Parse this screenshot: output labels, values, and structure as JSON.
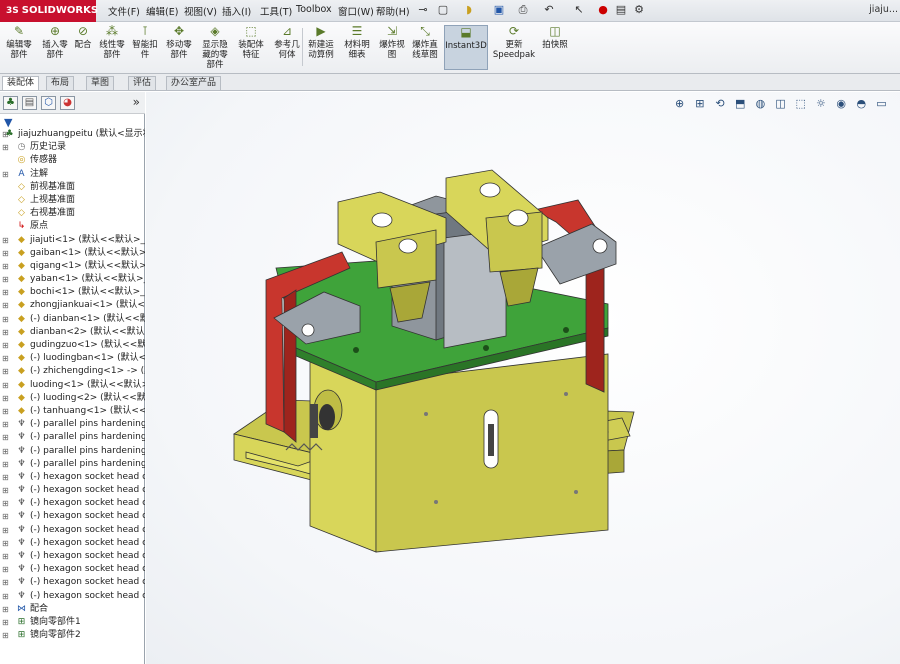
{
  "app": {
    "brand": "SOLIDWORKS",
    "brand_prefix": "3S",
    "document_title": "jiaju..."
  },
  "menu": {
    "items": [
      "文件(F)",
      "编辑(E)",
      "视图(V)",
      "插入(I)",
      "工具(T)",
      "Toolbox",
      "窗口(W)",
      "帮助(H)"
    ]
  },
  "commands": [
    {
      "label": "编辑零\n部件",
      "icon": "edit-component-icon"
    },
    {
      "label": "插入零\n部件",
      "icon": "insert-component-icon"
    },
    {
      "label": "配合",
      "icon": "mate-icon"
    },
    {
      "label": "线性零\n部件",
      "icon": "linear-pattern-icon"
    },
    {
      "label": "智能扣\n件",
      "icon": "smart-fastener-icon"
    },
    {
      "label": "移动零\n部件",
      "icon": "move-component-icon"
    },
    {
      "label": "显示隐\n藏的零\n部件",
      "icon": "show-hidden-icon"
    },
    {
      "label": "装配体\n特征",
      "icon": "assembly-feature-icon"
    },
    {
      "label": "参考几\n何体",
      "icon": "reference-geometry-icon"
    },
    {
      "label": "新建运\n动算例",
      "icon": "motion-study-icon"
    },
    {
      "label": "材料明\n细表",
      "icon": "bom-icon"
    },
    {
      "label": "爆炸视\n图",
      "icon": "exploded-view-icon"
    },
    {
      "label": "爆炸直\n线草图",
      "icon": "explode-line-icon"
    },
    {
      "label": "Instant3D",
      "icon": "instant3d-icon"
    },
    {
      "label": "更新\nSpeedpak",
      "icon": "speedpak-icon"
    },
    {
      "label": "拍快照",
      "icon": "snapshot-icon"
    }
  ],
  "tabs": [
    "装配体",
    "布局",
    "草图",
    "评估",
    "办公室产品"
  ],
  "tree": {
    "root": "jiajuzhuangpeitu  (默认<显示状",
    "items": [
      {
        "label": "历史记录",
        "icon": "history-icon",
        "expand": true,
        "indent": 1
      },
      {
        "label": "传感器",
        "icon": "sensor-icon",
        "expand": false,
        "indent": 1
      },
      {
        "label": "注解",
        "icon": "annotation-icon",
        "expand": true,
        "indent": 1
      },
      {
        "label": "前视基准面",
        "icon": "plane-icon",
        "expand": false,
        "indent": 1
      },
      {
        "label": "上视基准面",
        "icon": "plane-icon",
        "expand": false,
        "indent": 1
      },
      {
        "label": "右视基准面",
        "icon": "plane-icon",
        "expand": false,
        "indent": 1
      },
      {
        "label": "原点",
        "icon": "origin-icon",
        "expand": false,
        "indent": 1
      },
      {
        "label": "jiajuti<1> (默认<<默认>_显",
        "icon": "part-icon",
        "expand": true,
        "indent": 1
      },
      {
        "label": "gaiban<1> (默认<<默认>_",
        "icon": "part-icon",
        "expand": true,
        "indent": 1
      },
      {
        "label": "qigang<1> (默认<<默认>_",
        "icon": "part-icon",
        "expand": true,
        "indent": 1
      },
      {
        "label": "yaban<1> (默认<<默认>_显",
        "icon": "part-icon",
        "expand": true,
        "indent": 1
      },
      {
        "label": "bochi<1> (默认<<默认>_显",
        "icon": "part-icon",
        "expand": true,
        "indent": 1
      },
      {
        "label": "zhongjiankuai<1> (默认<<",
        "icon": "part-icon",
        "expand": true,
        "indent": 1
      },
      {
        "label": "(-) dianban<1> (默认<<默",
        "icon": "part-icon",
        "expand": true,
        "indent": 1
      },
      {
        "label": "dianban<2> (默认<<默认>",
        "icon": "part-icon",
        "expand": true,
        "indent": 1
      },
      {
        "label": "gudingzuo<1> (默认<<默认",
        "icon": "part-icon",
        "expand": true,
        "indent": 1
      },
      {
        "label": "(-) luodingban<1> (默认<<",
        "icon": "part-icon",
        "expand": true,
        "indent": 1
      },
      {
        "label": "(-) zhichengding<1> -> (默",
        "icon": "part-icon",
        "expand": true,
        "indent": 1
      },
      {
        "label": "luoding<1> (默认<<默认>_",
        "icon": "part-icon",
        "expand": true,
        "indent": 1
      },
      {
        "label": "(-) luoding<2> (默认<<默",
        "icon": "part-icon",
        "expand": true,
        "indent": 1
      },
      {
        "label": "(-) tanhuang<1> (默认<<默",
        "icon": "part-icon",
        "expand": true,
        "indent": 1
      },
      {
        "label": "(-) parallel pins hardening",
        "icon": "toolbox-icon",
        "expand": true,
        "indent": 1
      },
      {
        "label": "(-) parallel pins hardening",
        "icon": "toolbox-icon",
        "expand": true,
        "indent": 1
      },
      {
        "label": "(-) parallel pins hardening",
        "icon": "toolbox-icon",
        "expand": true,
        "indent": 1
      },
      {
        "label": "(-) parallel pins hardening",
        "icon": "toolbox-icon",
        "expand": true,
        "indent": 1
      },
      {
        "label": "(-) hexagon socket head c",
        "icon": "toolbox-icon",
        "expand": true,
        "indent": 1
      },
      {
        "label": "(-) hexagon socket head c",
        "icon": "toolbox-icon",
        "expand": true,
        "indent": 1
      },
      {
        "label": "(-) hexagon socket head c",
        "icon": "toolbox-icon",
        "expand": true,
        "indent": 1
      },
      {
        "label": "(-) hexagon socket head c",
        "icon": "toolbox-icon",
        "expand": true,
        "indent": 1
      },
      {
        "label": "(-) hexagon socket head c",
        "icon": "toolbox-icon",
        "expand": true,
        "indent": 1
      },
      {
        "label": "(-) hexagon socket head c",
        "icon": "toolbox-icon",
        "expand": true,
        "indent": 1
      },
      {
        "label": "(-) hexagon socket head c",
        "icon": "toolbox-icon",
        "expand": true,
        "indent": 1
      },
      {
        "label": "(-) hexagon socket head c",
        "icon": "toolbox-icon",
        "expand": true,
        "indent": 1
      },
      {
        "label": "(-) hexagon socket head c",
        "icon": "toolbox-icon",
        "expand": true,
        "indent": 1
      },
      {
        "label": "(-) hexagon socket head c",
        "icon": "toolbox-icon",
        "expand": true,
        "indent": 1
      },
      {
        "label": "配合",
        "icon": "mates-icon",
        "expand": true,
        "indent": 1
      },
      {
        "label": "镜向零部件1",
        "icon": "mirror-icon",
        "expand": true,
        "indent": 1
      },
      {
        "label": "镜向零部件2",
        "icon": "mirror-icon",
        "expand": true,
        "indent": 1
      }
    ]
  },
  "colors": {
    "yellow": "#d8d65a",
    "green": "#3fa33a",
    "red": "#c8362d",
    "gray": "#9aa2aa",
    "brand": "#c8102e"
  }
}
